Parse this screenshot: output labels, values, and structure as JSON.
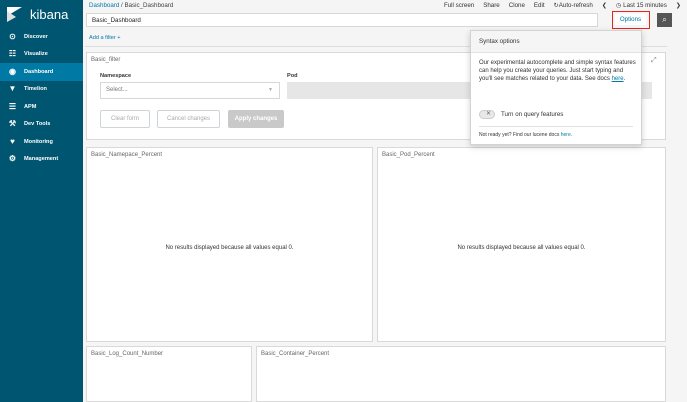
{
  "app": {
    "name": "kibana"
  },
  "sidebar": {
    "items": [
      {
        "label": "Discover",
        "icon": "compass-icon",
        "glyph": "⊙"
      },
      {
        "label": "Visualize",
        "icon": "bar-chart-icon",
        "glyph": "☷"
      },
      {
        "label": "Dashboard",
        "icon": "dashboard-icon",
        "glyph": "◉",
        "active": true
      },
      {
        "label": "Timelion",
        "icon": "shield-icon",
        "glyph": "▼"
      },
      {
        "label": "APM",
        "icon": "list-icon",
        "glyph": "☰"
      },
      {
        "label": "Dev Tools",
        "icon": "wrench-icon",
        "glyph": "⚒"
      },
      {
        "label": "Monitoring",
        "icon": "heartbeat-icon",
        "glyph": "♥"
      },
      {
        "label": "Management",
        "icon": "gear-icon",
        "glyph": "⚙"
      }
    ]
  },
  "breadcrumb": {
    "root": "Dashboard",
    "separator": " / ",
    "current": "Basic_Dashboard"
  },
  "topmenu": {
    "full_screen": "Full screen",
    "share": "Share",
    "clone": "Clone",
    "edit": "Edit",
    "auto_refresh": "Auto-refresh",
    "prev": "❮",
    "time": "Last 15 minutes",
    "next": "❯"
  },
  "search": {
    "value": "Basic_Dashboard",
    "options_label": "Options",
    "go_icon": "⌕"
  },
  "filters": {
    "add_label": "Add a filter +"
  },
  "filter_panel": {
    "title": "Basic_filter",
    "namespace_label": "Namespace",
    "namespace_placeholder": "Select...",
    "pod_label": "Pod",
    "clear_label": "Clear form",
    "cancel_label": "Cancel changes",
    "apply_label": "Apply changes"
  },
  "syntax_popover": {
    "title": "Syntax options",
    "body": "Our experimental autocomplete and simple syntax features can help you create your queries. Just start typing and you'll see matches related to your data. See docs",
    "docs_link": "here",
    "toggle_label": "Turn on query features",
    "footer_text": "Not ready yet? Find our lucene docs",
    "footer_link": "here",
    "expand_icon": "⤢"
  },
  "panels": [
    {
      "title": "Basic_Namepace_Percent",
      "message": "No results displayed because all values equal 0."
    },
    {
      "title": "Basic_Pod_Percent",
      "message": "No results displayed because all values equal 0."
    },
    {
      "title": "Basic_Log_Count_Number"
    },
    {
      "title": "Basic_Container_Percent"
    }
  ],
  "colors": {
    "sidebar": "#005571",
    "active": "#0079a5",
    "link": "#0079a5",
    "highlight": "#e8241b"
  }
}
